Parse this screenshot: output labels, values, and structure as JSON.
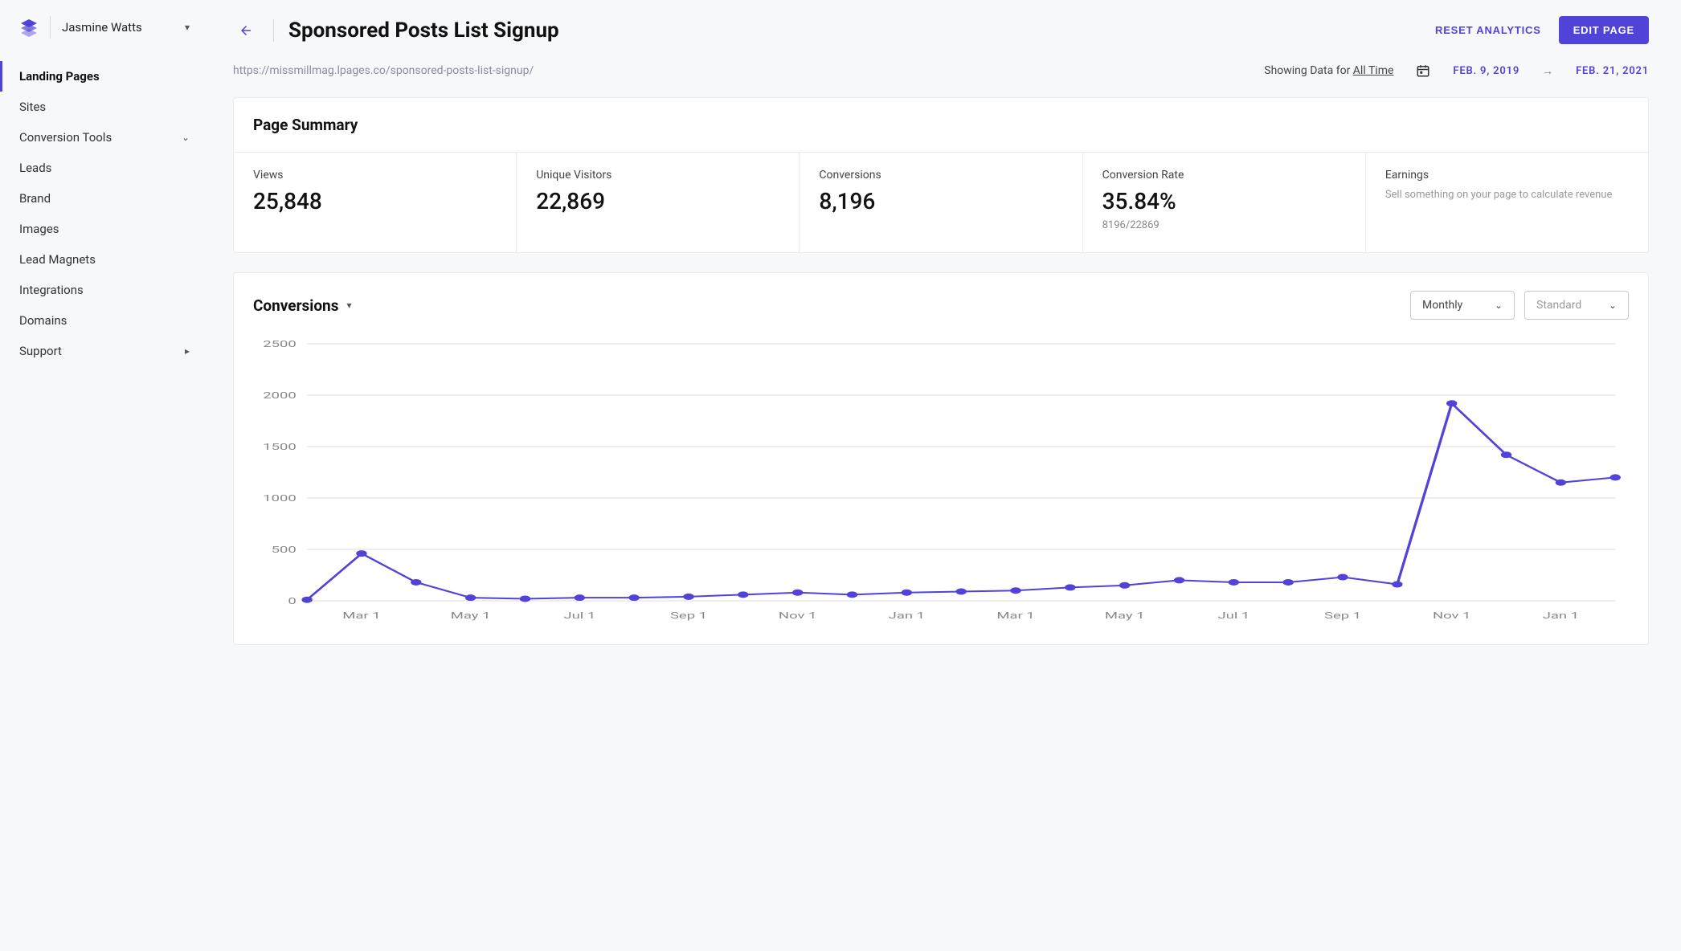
{
  "brand": {
    "user_name": "Jasmine Watts"
  },
  "sidebar": {
    "items": [
      {
        "label": "Landing Pages",
        "active": true
      },
      {
        "label": "Sites"
      },
      {
        "label": "Conversion Tools",
        "expandable": true
      },
      {
        "label": "Leads"
      },
      {
        "label": "Brand"
      },
      {
        "label": "Images"
      },
      {
        "label": "Lead Magnets"
      },
      {
        "label": "Integrations"
      },
      {
        "label": "Domains"
      },
      {
        "label": "Support",
        "submenu": true
      }
    ]
  },
  "header": {
    "title": "Sponsored Posts List Signup",
    "reset_label": "RESET ANALYTICS",
    "edit_label": "EDIT PAGE"
  },
  "meta": {
    "url": "https://missmillmag.lpages.co/sponsored-posts-list-signup/",
    "showing_prefix": "Showing Data for ",
    "showing_range": "All Time",
    "date_from": "FEB. 9, 2019",
    "date_to": "FEB. 21, 2021"
  },
  "summary": {
    "title": "Page Summary",
    "cells": [
      {
        "label": "Views",
        "value": "25,848"
      },
      {
        "label": "Unique Visitors",
        "value": "22,869"
      },
      {
        "label": "Conversions",
        "value": "8,196"
      },
      {
        "label": "Conversion Rate",
        "value": "35.84%",
        "sub": "8196/22869"
      },
      {
        "label": "Earnings",
        "desc": "Sell something on your page to calculate revenue"
      }
    ]
  },
  "chart_section": {
    "title": "Conversions",
    "select_interval": "Monthly",
    "select_mode": "Standard"
  },
  "chart_data": {
    "type": "line",
    "title": "Conversions",
    "ylabel": "",
    "xlabel": "",
    "ylim": [
      0,
      2500
    ],
    "yticks": [
      0,
      500,
      1000,
      1500,
      2000,
      2500
    ],
    "xticks": [
      "Mar 1",
      "May 1",
      "Jul 1",
      "Sep 1",
      "Nov 1",
      "Jan 1",
      "Mar 1",
      "May 1",
      "Jul 1",
      "Sep 1",
      "Nov 1",
      "Jan 1"
    ],
    "x": [
      "Feb 1 2019",
      "Mar 1 2019",
      "Apr 1 2019",
      "May 1 2019",
      "Jun 1 2019",
      "Jul 1 2019",
      "Aug 1 2019",
      "Sep 1 2019",
      "Oct 1 2019",
      "Nov 1 2019",
      "Dec 1 2019",
      "Jan 1 2020",
      "Feb 1 2020",
      "Mar 1 2020",
      "Apr 1 2020",
      "May 1 2020",
      "Jun 1 2020",
      "Jul 1 2020",
      "Aug 1 2020",
      "Sep 1 2020",
      "Oct 1 2020",
      "Nov 1 2020",
      "Dec 1 2020",
      "Jan 1 2021"
    ],
    "values": [
      10,
      460,
      180,
      30,
      20,
      30,
      30,
      40,
      60,
      80,
      60,
      80,
      90,
      100,
      130,
      150,
      200,
      180,
      180,
      230,
      160,
      1920,
      1420,
      1150,
      1200
    ]
  },
  "colors": {
    "accent": "#5142d8"
  }
}
